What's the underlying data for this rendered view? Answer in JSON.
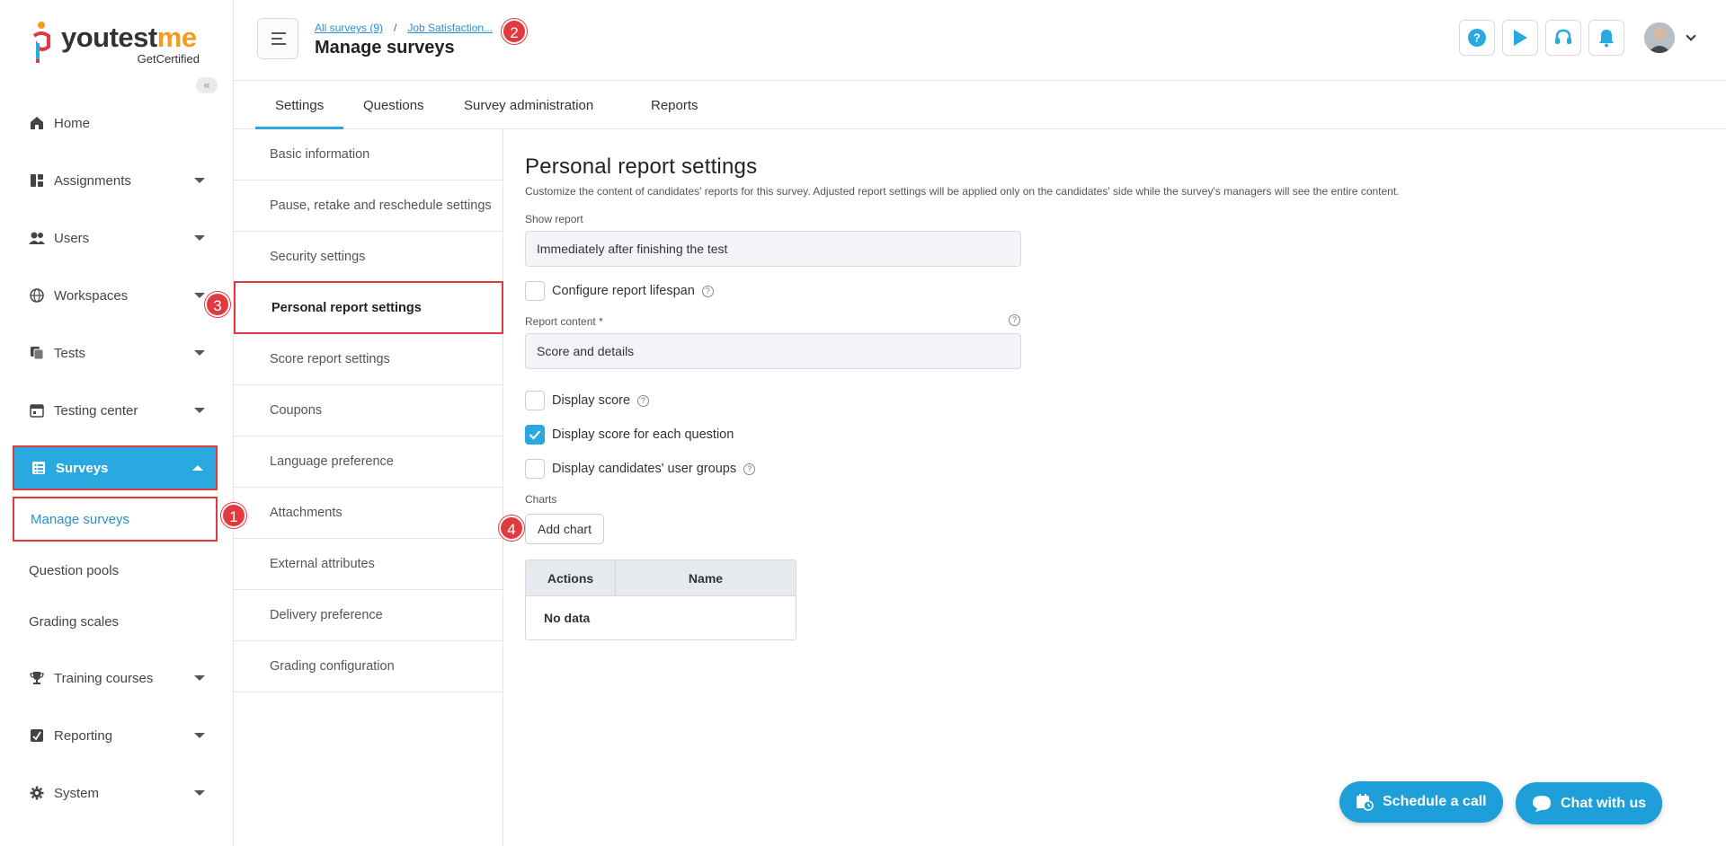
{
  "brand": {
    "logo_pre": "youtest",
    "logo_post": "me",
    "logo_sub": "GetCertified",
    "collapse_glyph": "«"
  },
  "sidebar": {
    "items": [
      {
        "label": "Home",
        "icon": "home-icon"
      },
      {
        "label": "Assignments",
        "icon": "assignments-icon"
      },
      {
        "label": "Users",
        "icon": "users-icon"
      },
      {
        "label": "Workspaces",
        "icon": "globe-icon"
      },
      {
        "label": "Tests",
        "icon": "tests-icon"
      },
      {
        "label": "Testing center",
        "icon": "calendar-icon"
      },
      {
        "label": "Surveys",
        "icon": "surveys-icon"
      },
      {
        "label": "Training courses",
        "icon": "trophy-icon"
      },
      {
        "label": "Reporting",
        "icon": "reporting-icon"
      },
      {
        "label": "System",
        "icon": "gear-icon"
      }
    ],
    "survey_subitems": [
      "Manage surveys",
      "Question pools",
      "Grading scales"
    ]
  },
  "markers": [
    "1",
    "2",
    "3",
    "4"
  ],
  "header": {
    "crumb_all": "All surveys (9)",
    "crumb_sep": "/",
    "crumb_current": "Job Satisfaction...",
    "title": "Manage surveys",
    "help_glyph": "?"
  },
  "tabs": [
    "Settings",
    "Questions",
    "Survey administration",
    "Reports"
  ],
  "settings_list": [
    "Basic information",
    "Pause, retake and reschedule settings",
    "Security settings",
    "Personal report settings",
    "Score report settings",
    "Coupons",
    "Language preference",
    "Attachments",
    "External attributes",
    "Delivery preference",
    "Grading configuration"
  ],
  "main": {
    "title": "Personal report settings",
    "description": "Customize the content of candidates' reports for this survey. Adjusted report settings will be applied only on the candidates' side while the survey's managers will see the entire content.",
    "show_report_label": "Show report",
    "show_report_value": "Immediately after finishing the test",
    "configure_lifespan": "Configure report lifespan",
    "report_content_label": "Report content",
    "required_mark": "*",
    "report_content_value": "Score and details",
    "display_score": "Display score",
    "display_score_each": "Display score for each question",
    "display_user_groups": "Display candidates' user groups",
    "charts_label": "Charts",
    "add_chart": "Add chart",
    "grid_col_actions": "Actions",
    "grid_col_name": "Name",
    "grid_empty": "No data",
    "help_glyph": "?"
  },
  "floating": {
    "schedule": "Schedule a call",
    "chat": "Chat with us"
  },
  "colors": {
    "accent": "#2aa8e0",
    "highlight": "#e0393e",
    "logo_orange": "#f39a1f"
  }
}
